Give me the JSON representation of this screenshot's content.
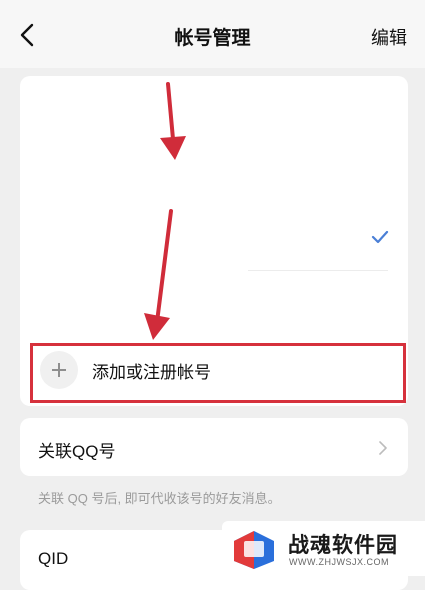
{
  "header": {
    "title": "帐号管理",
    "edit_label": "编辑"
  },
  "accounts": {
    "add_label": "添加或注册帐号"
  },
  "qq_link": {
    "label": "关联QQ号",
    "hint": "关联 QQ 号后, 即可代收该号的好友消息。"
  },
  "qid": {
    "label": "QID"
  },
  "watermark": {
    "name": "战魂软件园",
    "url": "WWW.ZHJWSJX.COM"
  },
  "colors": {
    "highlight": "#d6313c",
    "check": "#4a7fd6",
    "background": "#efefef"
  }
}
